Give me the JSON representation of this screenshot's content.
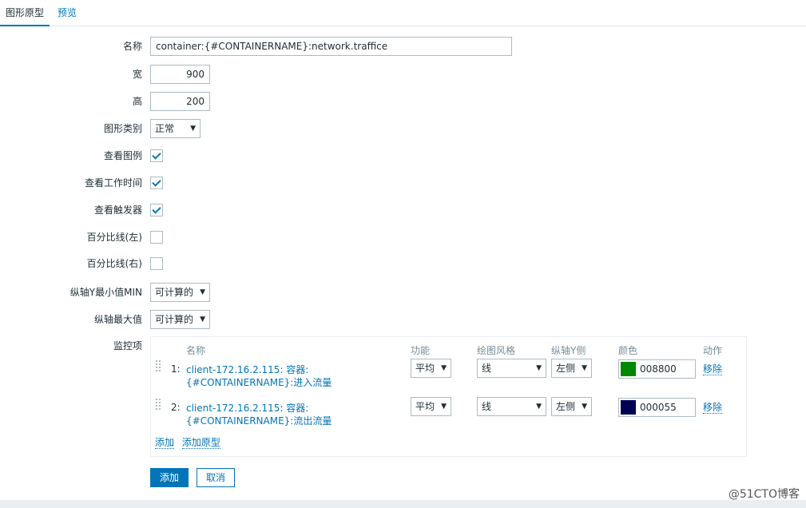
{
  "tabs": [
    {
      "label": "图形原型"
    },
    {
      "label": "预览"
    }
  ],
  "form": {
    "name_label": "名称",
    "name_value": "container:{#CONTAINERNAME}:network.traffice",
    "width_label": "宽",
    "width_value": "900",
    "height_label": "高",
    "height_value": "200",
    "graph_type_label": "图形类别",
    "graph_type_value": "正常",
    "show_legend_label": "查看图例",
    "show_legend_checked": true,
    "show_working_time_label": "查看工作时间",
    "show_working_time_checked": true,
    "show_triggers_label": "查看触发器",
    "show_triggers_checked": true,
    "percentile_left_label": "百分比线(左)",
    "percentile_left_checked": false,
    "percentile_right_label": "百分比线(右)",
    "percentile_right_checked": false,
    "ymin_label": "纵轴Y最小值MIN",
    "ymin_value": "可计算的",
    "ymax_label": "纵轴最大值",
    "ymax_value": "可计算的",
    "items_label": "监控项"
  },
  "items_table": {
    "headers": {
      "name": "名称",
      "function": "功能",
      "draw_style": "绘图风格",
      "y_axis_side": "纵轴Y侧",
      "color": "颜色",
      "action": "动作"
    },
    "rows": [
      {
        "index": "1:",
        "name": "client-172.16.2.115: 容器:{#CONTAINERNAME}:进入流量",
        "function": "平均",
        "draw_style": "线",
        "y_axis_side": "左侧",
        "color_hex": "#008800",
        "color_text": "008800",
        "action": "移除"
      },
      {
        "index": "2:",
        "name": "client-172.16.2.115: 容器:{#CONTAINERNAME}:流出流量",
        "function": "平均",
        "draw_style": "线",
        "y_axis_side": "左侧",
        "color_hex": "#000055",
        "color_text": "000055",
        "action": "移除"
      }
    ],
    "add_label": "添加",
    "add_prototype_label": "添加原型"
  },
  "buttons": {
    "add": "添加",
    "cancel": "取消"
  },
  "watermark": "@51CTO博客",
  "icons": {
    "dropdown": "triangle-down-icon",
    "checkbox_checked": "check-icon",
    "drag": "drag-handle-icon"
  },
  "colors": {
    "accent": "#0275b8",
    "border": "#acbbc2"
  }
}
